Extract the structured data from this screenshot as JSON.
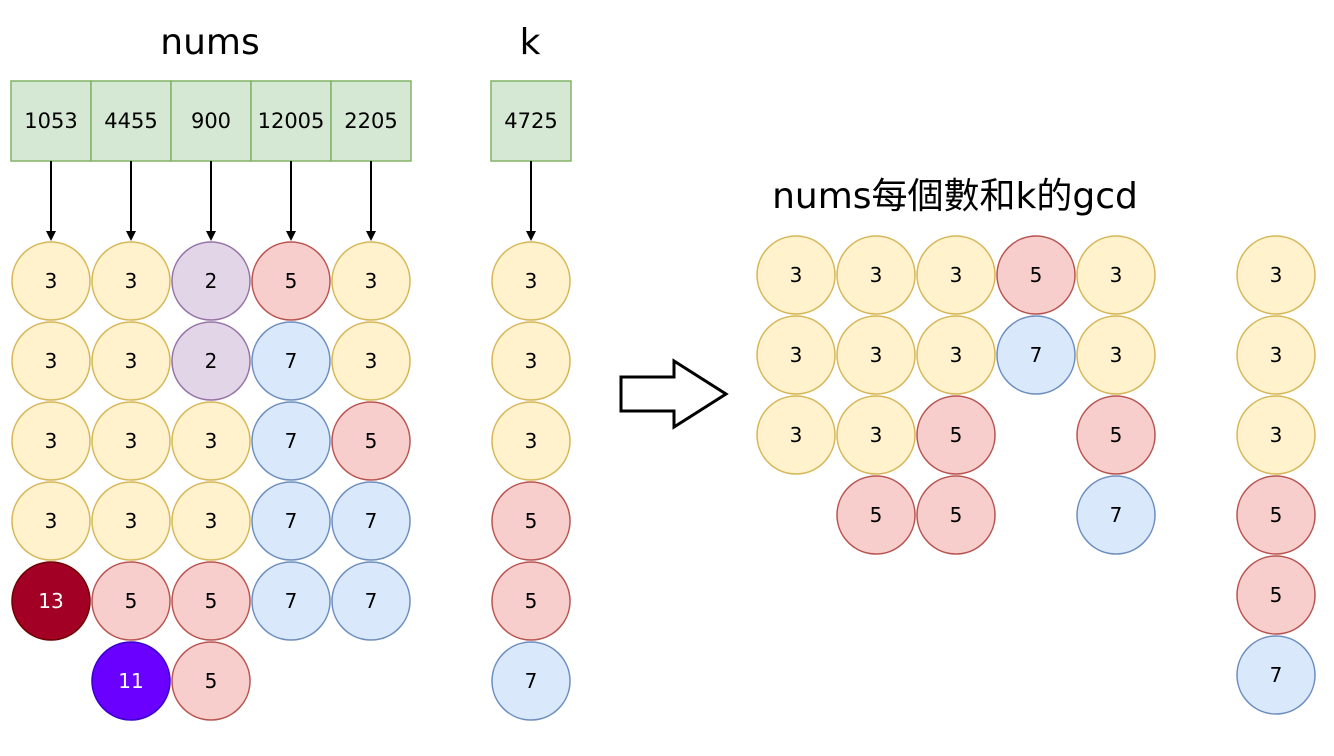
{
  "labels": {
    "nums": "nums",
    "k": "k",
    "result": "nums每個數和k的gcd"
  },
  "nums": [
    "1053",
    "4455",
    "900",
    "12005",
    "2205"
  ],
  "k": "4725",
  "colors": {
    "3": {
      "fill": "#fff2cc",
      "stroke": "#d6b656",
      "text": "#000000"
    },
    "2": {
      "fill": "#e1d5e7",
      "stroke": "#9673a6",
      "text": "#000000"
    },
    "5": {
      "fill": "#f8cecc",
      "stroke": "#b85450",
      "text": "#000000"
    },
    "7": {
      "fill": "#dae8fc",
      "stroke": "#6c8ebf",
      "text": "#000000"
    },
    "13": {
      "fill": "#a20025",
      "stroke": "#6f0000",
      "text": "#ffffff"
    },
    "11": {
      "fill": "#6a00ff",
      "stroke": "#3700cc",
      "text": "#ffffff"
    }
  },
  "nums_factors": [
    [
      "3",
      "3",
      "3",
      "3",
      "13"
    ],
    [
      "3",
      "3",
      "3",
      "3",
      "5",
      "11"
    ],
    [
      "2",
      "2",
      "3",
      "3",
      "5",
      "5"
    ],
    [
      "5",
      "7",
      "7",
      "7",
      "7"
    ],
    [
      "3",
      "3",
      "5",
      "7",
      "7"
    ]
  ],
  "k_factors": [
    "3",
    "3",
    "3",
    "5",
    "5",
    "7"
  ],
  "gcd_factors": [
    [
      "3",
      "3",
      "3"
    ],
    [
      "3",
      "3",
      "3",
      "5"
    ],
    [
      "3",
      "3",
      "5",
      "5"
    ],
    [
      "5",
      "7"
    ],
    [
      "3",
      "3",
      "5",
      "7"
    ]
  ],
  "right_k_factors": [
    "3",
    "3",
    "3",
    "5",
    "5",
    "7"
  ]
}
